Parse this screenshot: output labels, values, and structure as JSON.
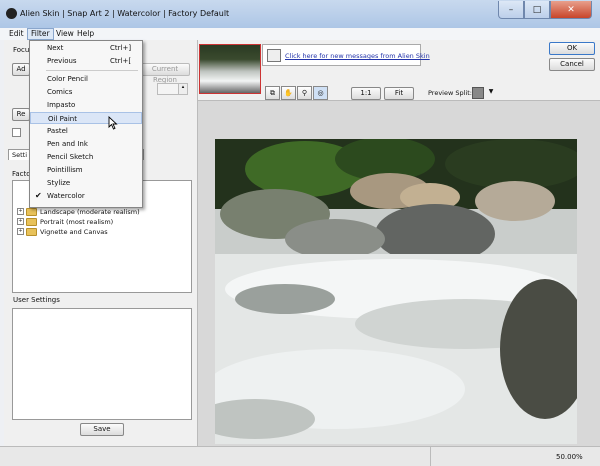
{
  "window": {
    "title": "Alien Skin | Snap Art 2 | Watercolor | Factory Default",
    "min": "–",
    "max": "□",
    "close": "✕"
  },
  "menubar": [
    "Edit",
    "Filter",
    "View",
    "Help"
  ],
  "filter_menu": {
    "items": [
      {
        "label": "Next",
        "shortcut": "Ctrl+]"
      },
      {
        "label": "Previous",
        "shortcut": "Ctrl+["
      },
      {
        "label": "Color Pencil"
      },
      {
        "label": "Comics"
      },
      {
        "label": "Impasto"
      },
      {
        "label": "Oil Paint"
      },
      {
        "label": "Pastel"
      },
      {
        "label": "Pen and Ink"
      },
      {
        "label": "Pencil Sketch"
      },
      {
        "label": "Pointillism"
      },
      {
        "label": "Stylize"
      },
      {
        "label": "Watercolor"
      }
    ],
    "highlighted": "Oil Paint",
    "checked": "Watercolor"
  },
  "left_panel": {
    "focus_label": "Focu",
    "add_button": "Ad",
    "current_region_button": "Current Region",
    "remove_button": "Re",
    "settings_tab": "Setti",
    "factory_label": "Facto",
    "factory_items": [
      "Landscape (moderate realism)",
      "Portrait (most realism)",
      "Vignette and Canvas"
    ],
    "user_settings_label": "User Settings",
    "save_button": "Save"
  },
  "toolbar": {
    "message_link": "Click here for new messages from Alien Skin",
    "zoom_1_1": "1:1",
    "fit": "Fit",
    "preview_split_label": "Preview Split:",
    "ok": "OK",
    "cancel": "Cancel"
  },
  "status": {
    "zoom": "50.00%"
  }
}
